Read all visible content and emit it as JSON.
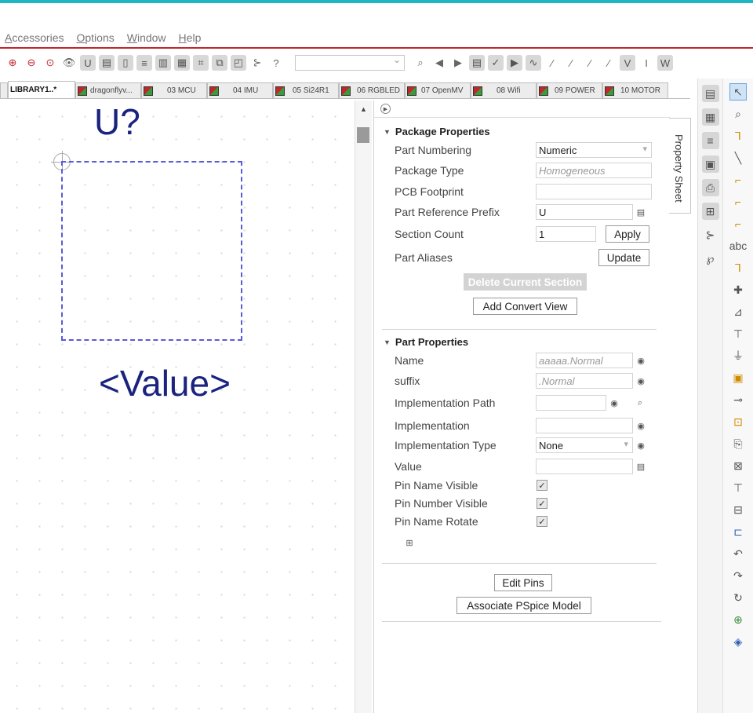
{
  "colors": {
    "accent_top": "#1fb5c4",
    "menu_rule": "#c0272d",
    "schematic_text": "#1a237e",
    "part_outline": "#5b5bd6"
  },
  "menu": {
    "items": [
      "Accessories",
      "Options",
      "Window",
      "Help"
    ]
  },
  "toolbar": {
    "icons": [
      "zoom-in-icon",
      "zoom-out-icon",
      "zoom-area-icon",
      "visibility-icon",
      "part-icon",
      "library-icon",
      "page-icon",
      "document-icon",
      "pages-icon",
      "report-icon",
      "netlist-icon",
      "copy-icon",
      "select-icon",
      "hierarchy-icon",
      "help-icon"
    ],
    "combo_value": "",
    "right_icons": [
      "search-icon",
      "prev-icon",
      "next-icon",
      "bom-icon",
      "drc-icon",
      "run-icon",
      "probe-icon",
      "pspice-a-icon",
      "pspice-b-icon",
      "pspice-c-icon",
      "pspice-d-icon",
      "voltage-icon",
      "current-icon",
      "power-icon"
    ]
  },
  "tabs": [
    {
      "label": "LIBRARY1..*",
      "active": true
    },
    {
      "label": "dragonflyv...",
      "active": false
    },
    {
      "label": "03 MCU",
      "active": false
    },
    {
      "label": "04 IMU",
      "active": false
    },
    {
      "label": "05 Si24R1",
      "active": false
    },
    {
      "label": "06 RGBLED",
      "active": false
    },
    {
      "label": "07 OpenMV",
      "active": false
    },
    {
      "label": "08 Wifi",
      "active": false
    },
    {
      "label": "09 POWER",
      "active": false
    },
    {
      "label": "10 MOTOR",
      "active": false
    }
  ],
  "schematic": {
    "ref": "U?",
    "value": "<Value>"
  },
  "package_properties": {
    "title": "Package Properties",
    "part_numbering_label": "Part Numbering",
    "part_numbering_value": "Numeric",
    "package_type_label": "Package Type",
    "package_type_value": "Homogeneous",
    "pcb_footprint_label": "PCB Footprint",
    "pcb_footprint_value": "",
    "ref_prefix_label": "Part Reference Prefix",
    "ref_prefix_value": "U",
    "section_count_label": "Section Count",
    "section_count_value": "1",
    "apply_label": "Apply",
    "aliases_label": "Part Aliases",
    "update_label": "Update",
    "delete_section_label": "Delete Current Section",
    "add_convert_label": "Add Convert View"
  },
  "part_properties": {
    "title": "Part Properties",
    "name_label": "Name",
    "name_value": "aaaaa.Normal",
    "suffix_label": "suffix",
    "suffix_value": ".Normal",
    "impl_path_label": "Implementation Path",
    "impl_path_value": "",
    "impl_label": "Implementation",
    "impl_value": "",
    "impl_type_label": "Implementation Type",
    "impl_type_value": "None",
    "value_label": "Value",
    "value_value": "",
    "pin_name_visible_label": "Pin Name Visible",
    "pin_name_visible": true,
    "pin_number_visible_label": "Pin Number Visible",
    "pin_number_visible": true,
    "pin_name_rotate_label": "Pin Name Rotate",
    "pin_name_rotate": true
  },
  "actions": {
    "edit_pins_label": "Edit Pins",
    "pspice_label": "Associate PSpice Model"
  },
  "property_sheet_tab": "Property Sheet",
  "right_toolbar_a": [
    "schematic-page-icon",
    "part-icon",
    "netlist-icon",
    "properties-icon",
    "print-icon",
    "new-part-icon",
    "hierarchy-icon",
    "pin-icon"
  ],
  "right_toolbar_b": [
    "pointer-icon",
    "search-part-icon",
    "wire-icon",
    "bus-icon",
    "bus-entry-icon",
    "net-alias-icon",
    "power-icon",
    "ground-icon",
    "text-icon",
    "junction-icon",
    "no-connect-icon",
    "off-page-icon",
    "port-icon",
    "block-icon",
    "pin-icon",
    "pin-array-icon",
    "line-icon",
    "rectangle-icon",
    "ellipse-icon",
    "arc-icon",
    "polyline-icon",
    "bezier-icon",
    "text-add-icon",
    "image-icon",
    "bookmark-icon",
    "ieee-icon"
  ]
}
